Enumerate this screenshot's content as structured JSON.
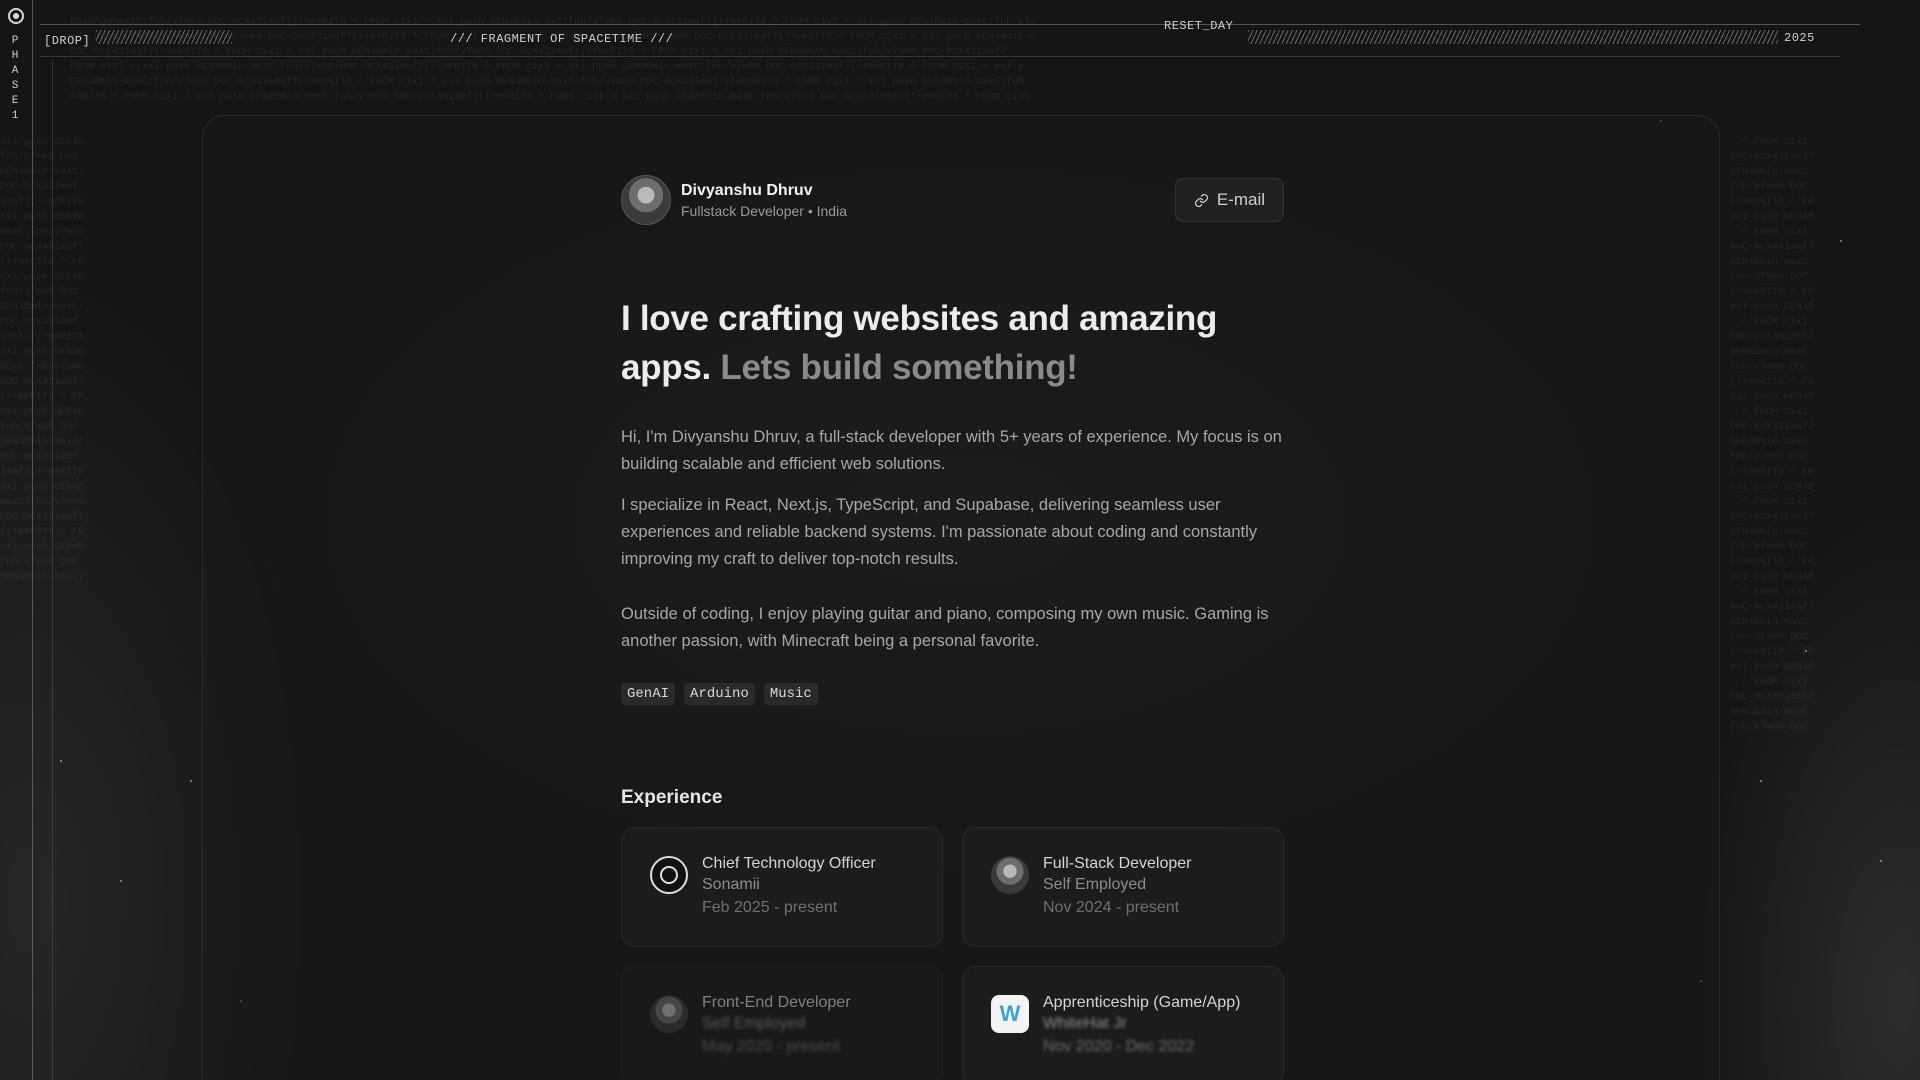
{
  "hud": {
    "drop_label": "[DROP]",
    "fragment_label": "/// FRAGMENT OF SPACETIME ///",
    "reset_label": "RESET_DAY",
    "year_label": "2025",
    "phase_letters": [
      "P",
      "H",
      "A",
      "S",
      "E",
      "1"
    ]
  },
  "profile": {
    "name": "Divyanshu Dhruv",
    "subtitle": "Fullstack Developer • India",
    "email_label": "E-mail"
  },
  "hero": {
    "headline_main": "I love crafting websites and amazing apps.",
    "headline_muted": "Lets build something!",
    "paragraphs": [
      "Hi, I'm Divyanshu Dhruv, a full-stack developer with 5+ years of experience. My focus is on building scalable and efficient web solutions.",
      "I specialize in React, Next.js, TypeScript, and Supabase, delivering seamless user experiences and reliable backend systems. I'm passionate about coding and constantly improving my craft to deliver top-notch results.",
      "Outside of coding, I enjoy playing guitar and piano, composing my own music. Gaming is another passion, with Minecraft being a personal favorite."
    ],
    "tags": [
      "GenAI",
      "Arduino",
      "Music"
    ]
  },
  "experience": {
    "title": "Experience",
    "items": [
      {
        "role": "Chief Technology Officer",
        "company": "Sonamii",
        "dates": "Feb 2025 - present",
        "logo": "sonamii-logo-icon"
      },
      {
        "role": "Full-Stack Developer",
        "company": "Self Employed",
        "dates": "Nov 2024 - present",
        "logo": "avatar-logo-icon"
      },
      {
        "role": "Front-End Developer",
        "company": "Self Employed",
        "dates": "May 2020 - present",
        "logo": "avatar-logo-icon"
      },
      {
        "role": "Apprenticeship (Game/App)",
        "company": "WhiteHat Jr",
        "dates": "Nov 2020 - Dec 2022",
        "logo": "whitehat-logo-icon"
      }
    ]
  }
}
